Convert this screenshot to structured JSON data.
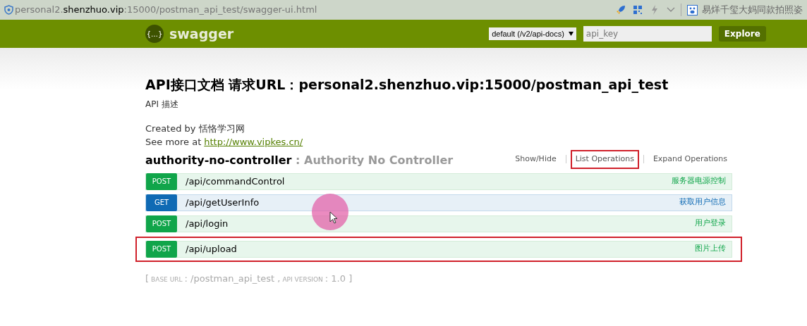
{
  "browser": {
    "url_host_prefix": "personal2.",
    "url_host": "shenzhuo.vip",
    "url_rest": ":15000/postman_api_test/swagger-ui.html",
    "tab_text": "易烊千玺大妈同款拍照姿"
  },
  "header": {
    "logo": "{…}",
    "brand": "swagger",
    "spec_select": "default (/v2/api-docs)",
    "api_key_placeholder": "api_key",
    "explore_button": "Explore"
  },
  "info": {
    "title": "API接口文档 请求URL：personal2.shenzhuo.vip:15000/postman_api_test",
    "description": "API 描述",
    "created_by": "Created by 恬恪学习网",
    "see_more_prefix": "See more at",
    "see_more_link": "http://www.vipkes.cn/"
  },
  "resource": {
    "name": "authority-no-controller",
    "separator": " : ",
    "description": "Authority No Controller",
    "actions": [
      {
        "label": "Show/Hide",
        "highlighted": false
      },
      {
        "label": "List Operations",
        "highlighted": true
      },
      {
        "label": "Expand Operations",
        "highlighted": false
      }
    ],
    "operations": [
      {
        "method": "POST",
        "path": "/api/commandControl",
        "summary": "服务器电源控制",
        "highlighted": false
      },
      {
        "method": "GET",
        "path": "/api/getUserInfo",
        "summary": "获取用户信息",
        "highlighted": false
      },
      {
        "method": "POST",
        "path": "/api/login",
        "summary": "用户登录",
        "highlighted": false
      },
      {
        "method": "POST",
        "path": "/api/upload",
        "summary": "图片上传",
        "highlighted": true
      }
    ]
  },
  "footer": {
    "base_url_label": "BASE URL",
    "base_url": ": /postman_api_test , ",
    "version_label": "API VERSION",
    "version": ": 1.0 ]",
    "open_bracket": "["
  }
}
